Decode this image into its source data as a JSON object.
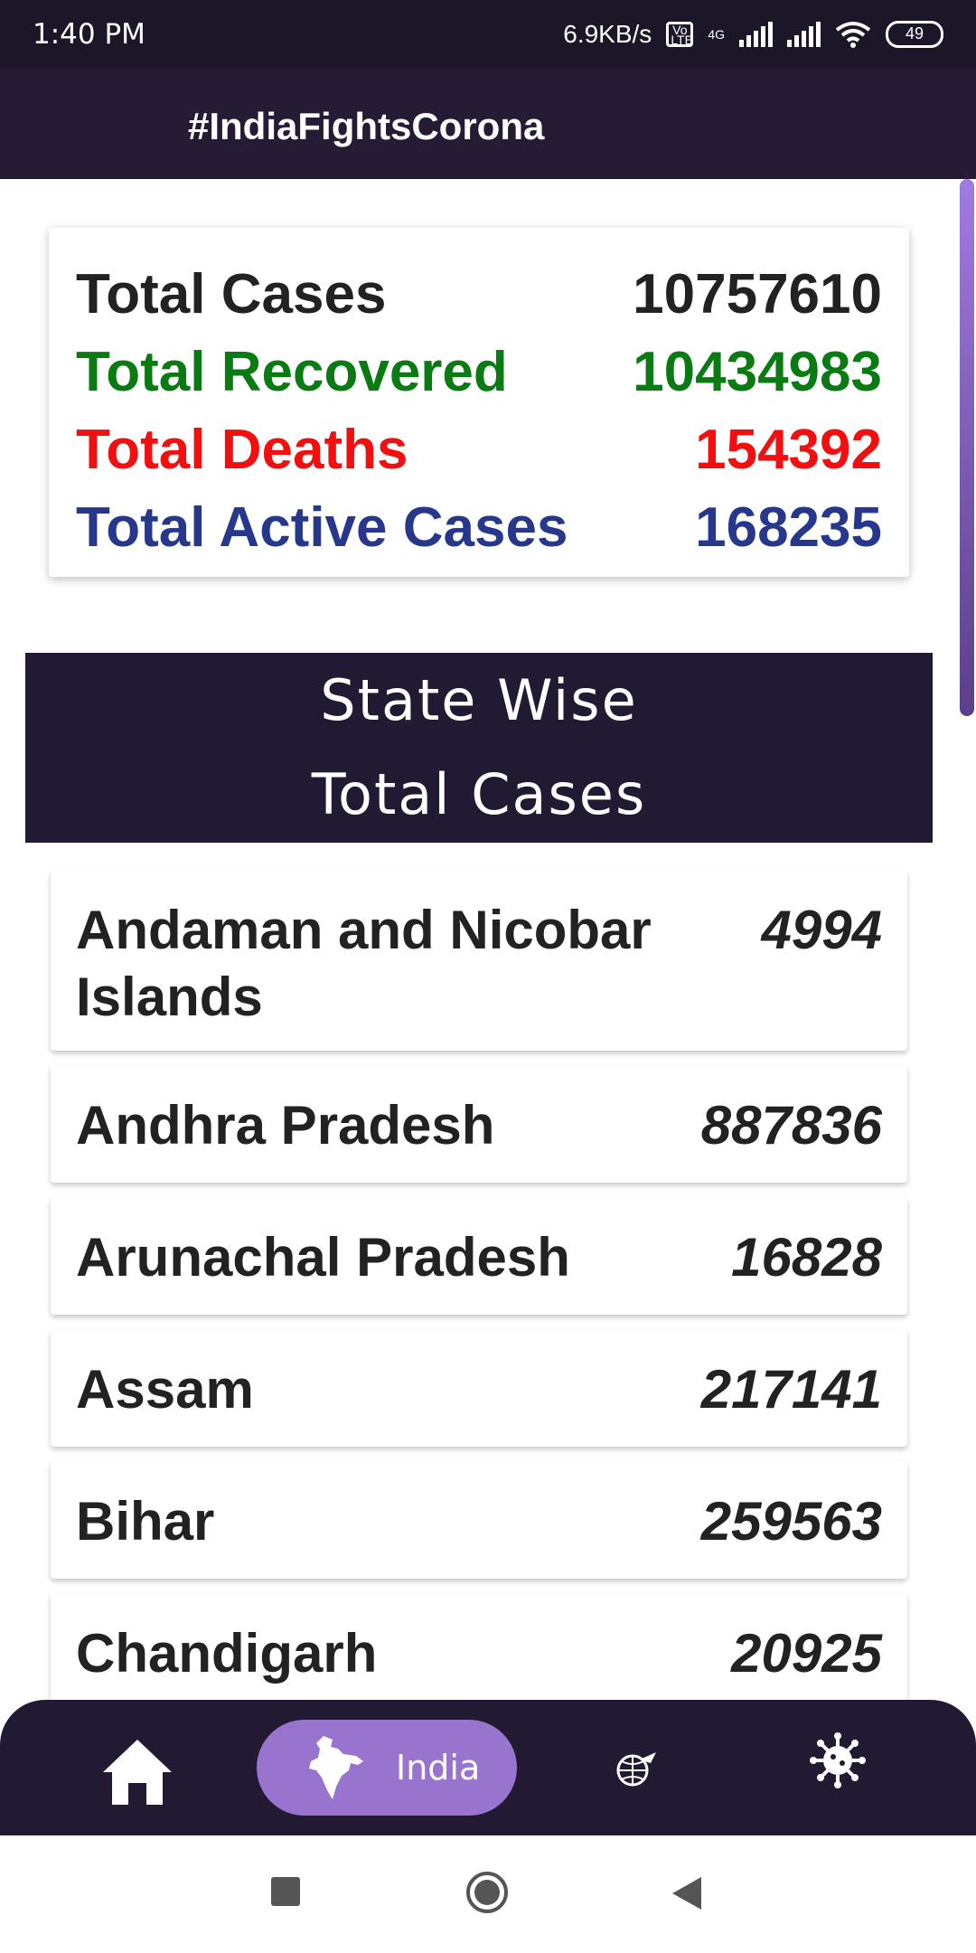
{
  "status_bar": {
    "time": "1:40 PM",
    "net_speed": "6.9KB/s",
    "volte": "Vo LTE",
    "network": "4G",
    "battery": "49"
  },
  "header": {
    "title": "#IndiaFightsCorona"
  },
  "summary": {
    "total_cases_label": "Total Cases",
    "total_cases_value": "10757610",
    "recovered_label": "Total Recovered",
    "recovered_value": "10434983",
    "deaths_label": "Total Deaths",
    "deaths_value": "154392",
    "active_label": "Total Active Cases",
    "active_value": "168235"
  },
  "section": {
    "line1": "State Wise",
    "line2": "Total Cases"
  },
  "states": [
    {
      "name": "Andaman and Nicobar Islands",
      "cases": "4994"
    },
    {
      "name": "Andhra Pradesh",
      "cases": "887836"
    },
    {
      "name": "Arunachal Pradesh",
      "cases": "16828"
    },
    {
      "name": "Assam",
      "cases": "217141"
    },
    {
      "name": "Bihar",
      "cases": "259563"
    },
    {
      "name": "Chandigarh",
      "cases": "20925"
    }
  ],
  "bottom_nav": {
    "items": [
      {
        "icon": "home-icon"
      },
      {
        "icon": "india-map-icon",
        "label": "India"
      },
      {
        "icon": "globe-plane-icon"
      },
      {
        "icon": "virus-icon"
      }
    ]
  },
  "colors": {
    "header_bg": "#261b35",
    "recovered": "#0a7a12",
    "deaths": "#f20f10",
    "active": "#27388c",
    "nav_active_pill": "#9874cf"
  }
}
